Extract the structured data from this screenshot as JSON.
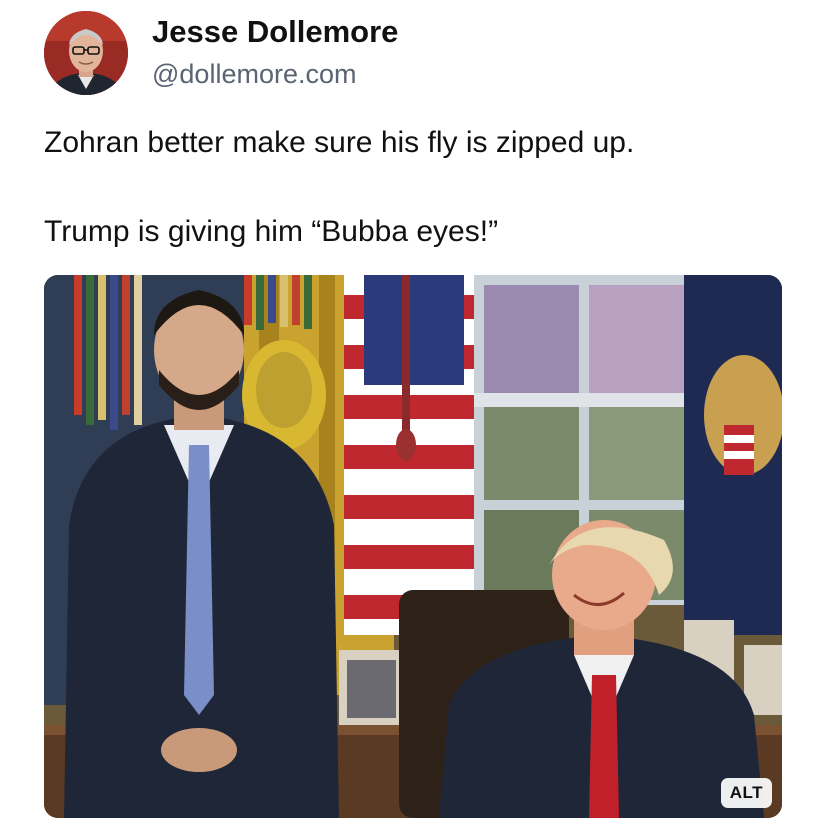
{
  "author": {
    "name": "Jesse Dollemore",
    "handle": "@dollemore.com"
  },
  "post": {
    "lines": [
      "Zohran better make sure his fly is zipped up.",
      "Trump is giving him “Bubba eyes!”"
    ]
  },
  "media": {
    "alt_label": "ALT"
  }
}
